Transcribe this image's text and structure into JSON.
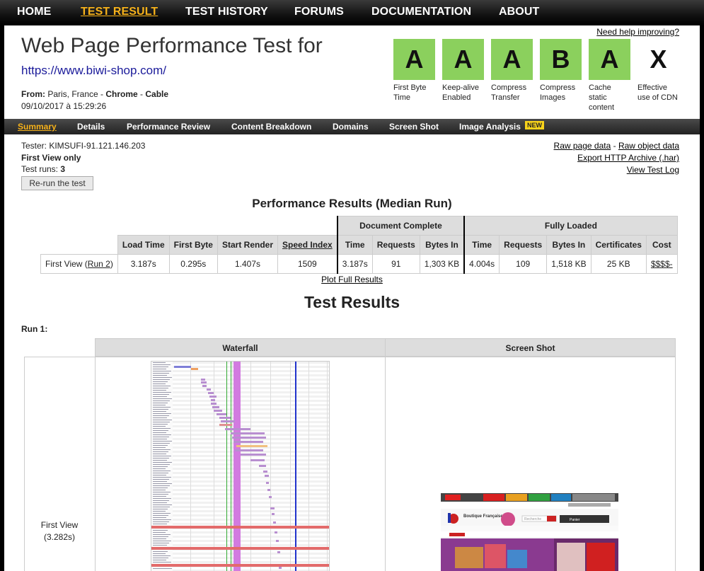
{
  "nav": {
    "items": [
      "HOME",
      "TEST RESULT",
      "TEST HISTORY",
      "FORUMS",
      "DOCUMENTATION",
      "ABOUT"
    ],
    "active": "TEST RESULT"
  },
  "header": {
    "title": "Web Page Performance Test for",
    "url": "https://www.biwi-shop.com/",
    "from_label": "From:",
    "location": "Paris, France",
    "browser": "Chrome",
    "connection": "Cable",
    "sep": " - ",
    "date": "09/10/2017 à 15:29:26",
    "help_link": "Need help improving?"
  },
  "grades": [
    {
      "grade": "A",
      "label": "First Byte Time",
      "color": "#8bd05d"
    },
    {
      "grade": "A",
      "label": "Keep-alive Enabled",
      "color": "#8bd05d"
    },
    {
      "grade": "A",
      "label": "Compress Transfer",
      "color": "#8bd05d"
    },
    {
      "grade": "B",
      "label": "Compress Images",
      "color": "#8bd05d"
    },
    {
      "grade": "A",
      "label": "Cache static content",
      "color": "#8bd05d"
    },
    {
      "grade": "X",
      "label": "Effective use of CDN",
      "color": "transparent"
    }
  ],
  "subnav": {
    "items": [
      "Summary",
      "Details",
      "Performance Review",
      "Content Breakdown",
      "Domains",
      "Screen Shot",
      "Image Analysis"
    ],
    "active": "Summary",
    "new_badge": "NEW"
  },
  "test_info": {
    "tester": "Tester: KIMSUFI-91.121.146.203",
    "view": "First View only",
    "runs_label": "Test runs: ",
    "runs": "3",
    "rerun": "Re-run the test"
  },
  "links": {
    "raw_page": "Raw page data",
    "dash": " - ",
    "raw_object": "Raw object data",
    "export": "Export HTTP Archive (.har)",
    "view_log": "View Test Log"
  },
  "performance": {
    "heading": "Performance Results (Median Run)",
    "group_doc": "Document Complete",
    "group_full": "Fully Loaded",
    "columns": [
      "Load Time",
      "First Byte",
      "Start Render",
      "Speed Index",
      "Time",
      "Requests",
      "Bytes In",
      "Time",
      "Requests",
      "Bytes In",
      "Certificates",
      "Cost"
    ],
    "row": {
      "label_prefix": "First View (",
      "run_link": "Run 2",
      "label_suffix": ")",
      "values": [
        "3.187s",
        "0.295s",
        "1.407s",
        "1509",
        "3.187s",
        "91",
        "1,303 KB",
        "4.004s",
        "109",
        "1,518 KB",
        "25 KB",
        "$$$$-"
      ]
    },
    "plot_link": "Plot Full Results"
  },
  "results": {
    "heading": "Test Results",
    "run_label": "Run 1:",
    "col_waterfall": "Waterfall",
    "col_screenshot": "Screen Shot",
    "first_view": "First View",
    "first_view_time": "(3.282s)"
  },
  "screenshot": {
    "site_title": "Boutique Française",
    "search_placeholder": "Recherche",
    "cart": "Panier"
  },
  "colors": {
    "accent": "#f7b21a",
    "grade_good": "#8bd05d",
    "link": "#1a1a9a"
  }
}
